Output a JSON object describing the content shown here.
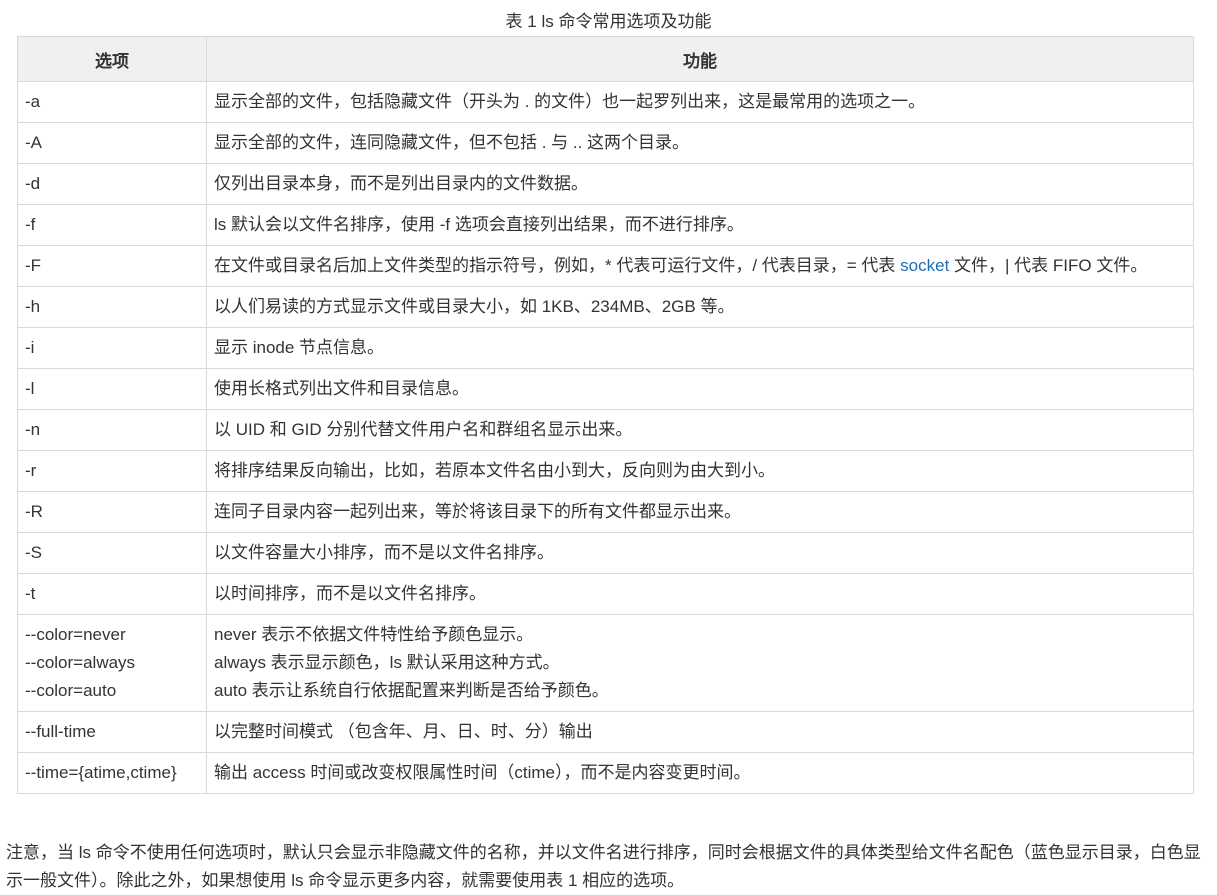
{
  "caption": "表 1 ls 命令常用选项及功能",
  "table": {
    "headers": {
      "option": "选项",
      "function": "功能"
    },
    "rows": [
      {
        "option": "-a",
        "function": "显示全部的文件，包括隐藏文件（开头为 . 的文件）也一起罗列出来，这是最常用的选项之一。"
      },
      {
        "option": "-A",
        "function": "显示全部的文件，连同隐藏文件，但不包括 . 与 .. 这两个目录。"
      },
      {
        "option": "-d",
        "function": "仅列出目录本身，而不是列出目录内的文件数据。"
      },
      {
        "option": "-f",
        "function": "ls 默认会以文件名排序，使用 -f 选项会直接列出结果，而不进行排序。"
      },
      {
        "option": "-F",
        "function_pre": "在文件或目录名后加上文件类型的指示符号，例如，* 代表可运行文件，/ 代表目录，= 代表 ",
        "function_link": "socket",
        "function_post": " 文件，| 代表 FIFO 文件。"
      },
      {
        "option": "-h",
        "function": "以人们易读的方式显示文件或目录大小，如 1KB、234MB、2GB 等。"
      },
      {
        "option": "-i",
        "function": "显示 inode 节点信息。"
      },
      {
        "option": "-l",
        "function": "使用长格式列出文件和目录信息。"
      },
      {
        "option": "-n",
        "function": "以 UID 和 GID 分别代替文件用户名和群组名显示出来。"
      },
      {
        "option": "-r",
        "function": "将排序结果反向输出，比如，若原本文件名由小到大，反向则为由大到小。"
      },
      {
        "option": "-R",
        "function": "连同子目录内容一起列出来，等於将该目录下的所有文件都显示出来。"
      },
      {
        "option": "-S",
        "function": "以文件容量大小排序，而不是以文件名排序。"
      },
      {
        "option": "-t",
        "function": "以时间排序，而不是以文件名排序。"
      },
      {
        "option_lines": [
          "--color=never",
          "--color=always",
          "--color=auto"
        ],
        "function_lines": [
          "never 表示不依据文件特性给予颜色显示。",
          "always 表示显示颜色，ls 默认采用这种方式。",
          "auto 表示让系统自行依据配置来判断是否给予颜色。"
        ]
      },
      {
        "option": "--full-time",
        "function": "以完整时间模式 （包含年、月、日、时、分）输出"
      },
      {
        "option": "--time={atime,ctime}",
        "function": "输出 access 时间或改变权限属性时间（ctime），而不是内容变更时间。"
      }
    ]
  },
  "note": "注意，当 ls 命令不使用任何选项时，默认只会显示非隐藏文件的名称，并以文件名进行排序，同时会根据文件的具体类型给文件名配色（蓝色显示目录，白色显示一般文件）。除此之外，如果想使用 ls 命令显示更多内容，就需要使用表 1 相应的选项。",
  "colors": {
    "link": "#1f6fb2",
    "header_bg": "#f0f0f0",
    "border": "#d9d9d9",
    "text": "#333333"
  }
}
